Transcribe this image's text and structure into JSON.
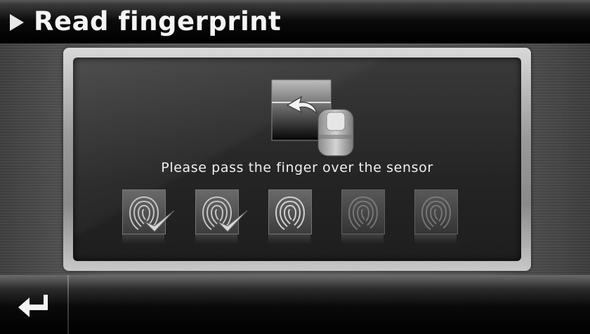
{
  "header": {
    "title": "Read fingerprint",
    "arrow_icon": "play-triangle-icon"
  },
  "dialog": {
    "sensor_icon": "finger-swipe-sensor-icon",
    "prompt": "Please pass the finger over the sensor",
    "scans": [
      {
        "icon": "fingerprint-icon",
        "status": "done"
      },
      {
        "icon": "fingerprint-icon",
        "status": "done"
      },
      {
        "icon": "fingerprint-icon",
        "status": "current"
      },
      {
        "icon": "fingerprint-icon",
        "status": "pending"
      },
      {
        "icon": "fingerprint-icon",
        "status": "pending"
      }
    ]
  },
  "footer": {
    "back_icon": "return-arrow-icon"
  },
  "colors": {
    "text": "#f0f0f0",
    "check": "#d8d8d8"
  }
}
